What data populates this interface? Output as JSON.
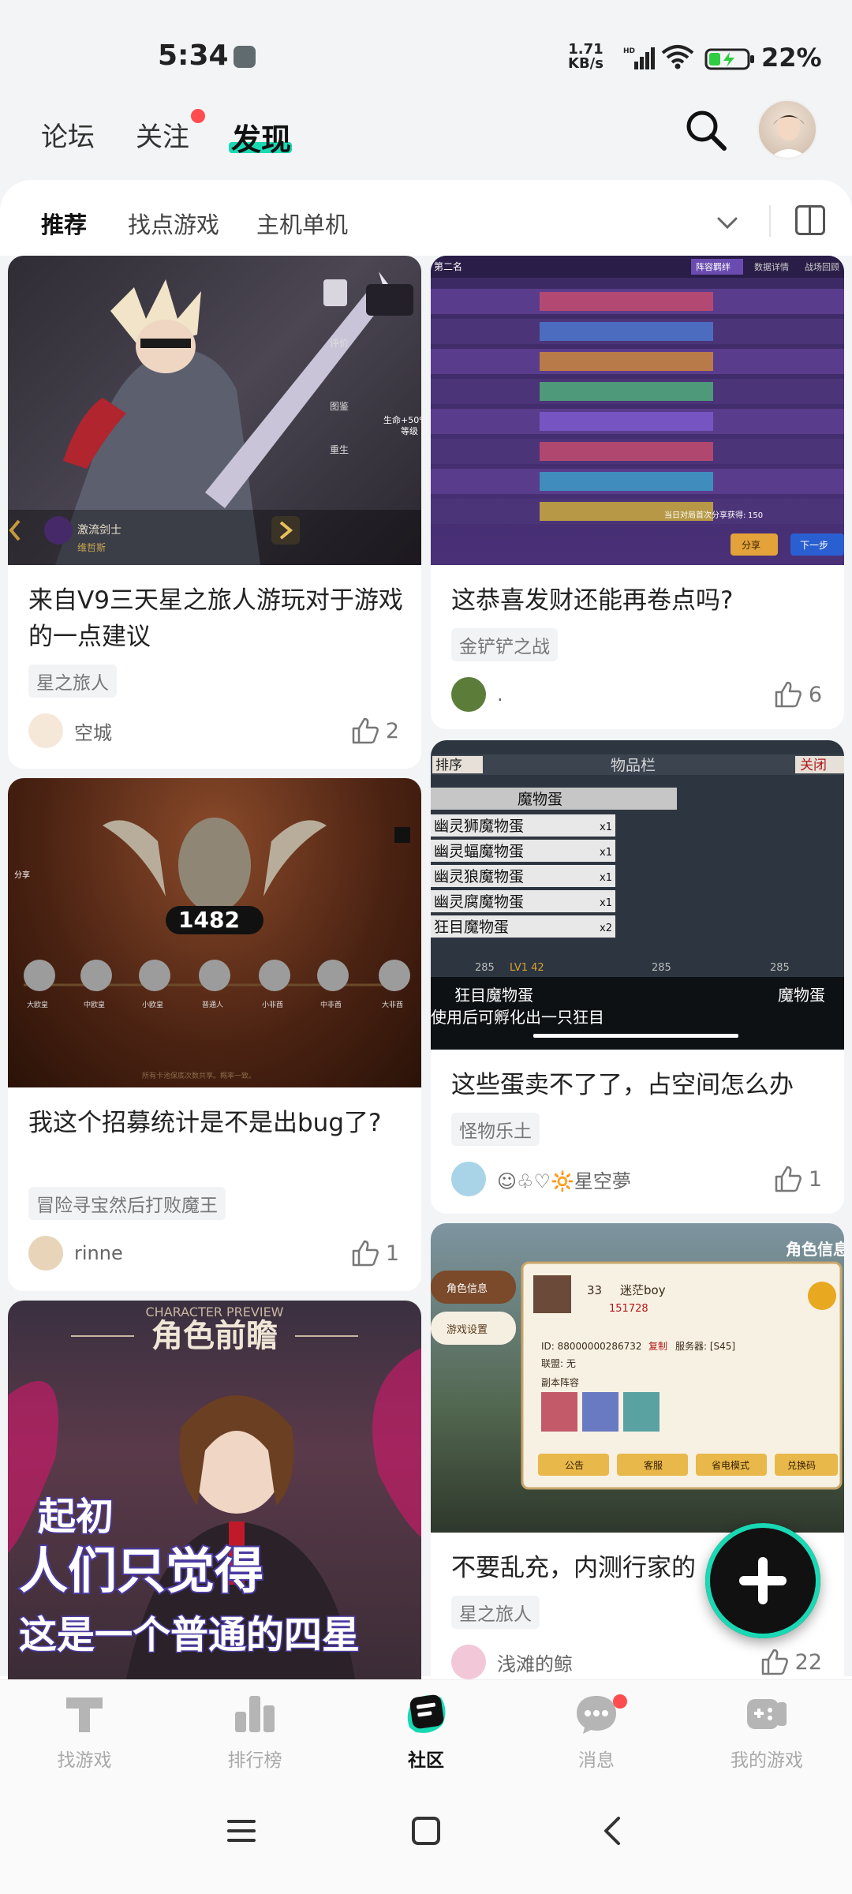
{
  "status_bar": {
    "time": "5:34",
    "net_speed_value": "1.71",
    "net_speed_unit": "KB/s",
    "battery": "22%"
  },
  "top_nav": {
    "tabs": [
      "论坛",
      "关注",
      "发现"
    ],
    "active": "发现"
  },
  "sub_tabs": [
    "推荐",
    "找点游戏",
    "主机单机"
  ],
  "posts": [
    {
      "title": "来自V9三天星之旅人游玩对于游戏的一点建议",
      "tag": "星之旅人",
      "author": "空城",
      "likes": "2",
      "image_text": {
        "char_name": "激流剑士",
        "char_sub": "维哲斯",
        "side_labels": [
          "评价",
          "图鉴",
          "重生"
        ],
        "stat": "生命+50%",
        "stat2": "等级"
      }
    },
    {
      "title": "这恭喜发财还能再卷点吗?",
      "tag": "金铲铲之战",
      "author": ".",
      "likes": "6",
      "image_text": {
        "rank": "第二名",
        "tab1": "阵容羁绊",
        "tab2": "数据详情",
        "tab3": "战场回顾",
        "btn_share": "分享",
        "btn_next": "下一步",
        "note": "当日对局首次分享获得:",
        "coins": "150"
      }
    },
    {
      "title": "我这个招募统计是不是出bug了?",
      "tag": "冒险寻宝然后打败魔王",
      "author": "rinne",
      "likes": "1",
      "image_text": {
        "count": "1482",
        "share": "分享",
        "tiers": [
          "大欧皇",
          "中欧皇",
          "小欧皇",
          "普通人",
          "小非酋",
          "中非酋",
          "大非酋"
        ],
        "footer": "所有卡池保底次数共享。概率一致。"
      }
    },
    {
      "title": "这些蛋卖不了了，占空间怎么办",
      "tag": "怪物乐土",
      "author": "☺♧♡🔆星空夢",
      "likes": "1",
      "image_text": {
        "sort": "排序",
        "header": "物品栏",
        "close": "关闭",
        "category": "魔物蛋",
        "items": [
          {
            "name": "幽灵狮魔物蛋",
            "qty": "x1"
          },
          {
            "name": "幽灵蝠魔物蛋",
            "qty": "x1"
          },
          {
            "name": "幽灵狼魔物蛋",
            "qty": "x1"
          },
          {
            "name": "幽灵腐魔物蛋",
            "qty": "x1"
          },
          {
            "name": "狂目魔物蛋",
            "qty": "x2"
          }
        ],
        "stat1": "285",
        "stat2": "285",
        "stat3": "285",
        "lv": "LV1 42",
        "detail_name": "狂目魔物蛋",
        "detail_type": "魔物蛋",
        "detail_desc": "使用后可孵化出一只狂目"
      }
    },
    {
      "title": "",
      "tag": "",
      "author": "",
      "likes": "",
      "image_text": {
        "preview_en": "CHARACTER PREVIEW",
        "preview_cn": "角色前瞻",
        "line1": "起初",
        "line2": "人们只觉得",
        "line3": "这是一个普通的四星"
      }
    },
    {
      "title": "不要乱充，内测行家的",
      "tag": "星之旅人",
      "author": "浅滩的鲸",
      "likes": "22",
      "image_text": {
        "header": "角色信息",
        "menu1": "角色信息",
        "menu2": "游戏设置",
        "name": "迷茫boy",
        "level": "33",
        "power": "151728",
        "id_line": "ID: 88000000286732",
        "copy": "复制",
        "server": "服务器: [S45]",
        "alliance": "联盟: 无",
        "team": "副本阵容",
        "b1": "公告",
        "b2": "客服",
        "b3": "省电模式",
        "b4": "兑换码"
      }
    }
  ],
  "bottom_nav": [
    {
      "label": "找游戏",
      "icon": "find-game-icon"
    },
    {
      "label": "排行榜",
      "icon": "ranking-icon"
    },
    {
      "label": "社区",
      "icon": "community-icon"
    },
    {
      "label": "消息",
      "icon": "message-icon"
    },
    {
      "label": "我的游戏",
      "icon": "my-games-icon"
    }
  ],
  "colors": {
    "accent": "#19d9b4",
    "badge": "#ff4d4f"
  }
}
